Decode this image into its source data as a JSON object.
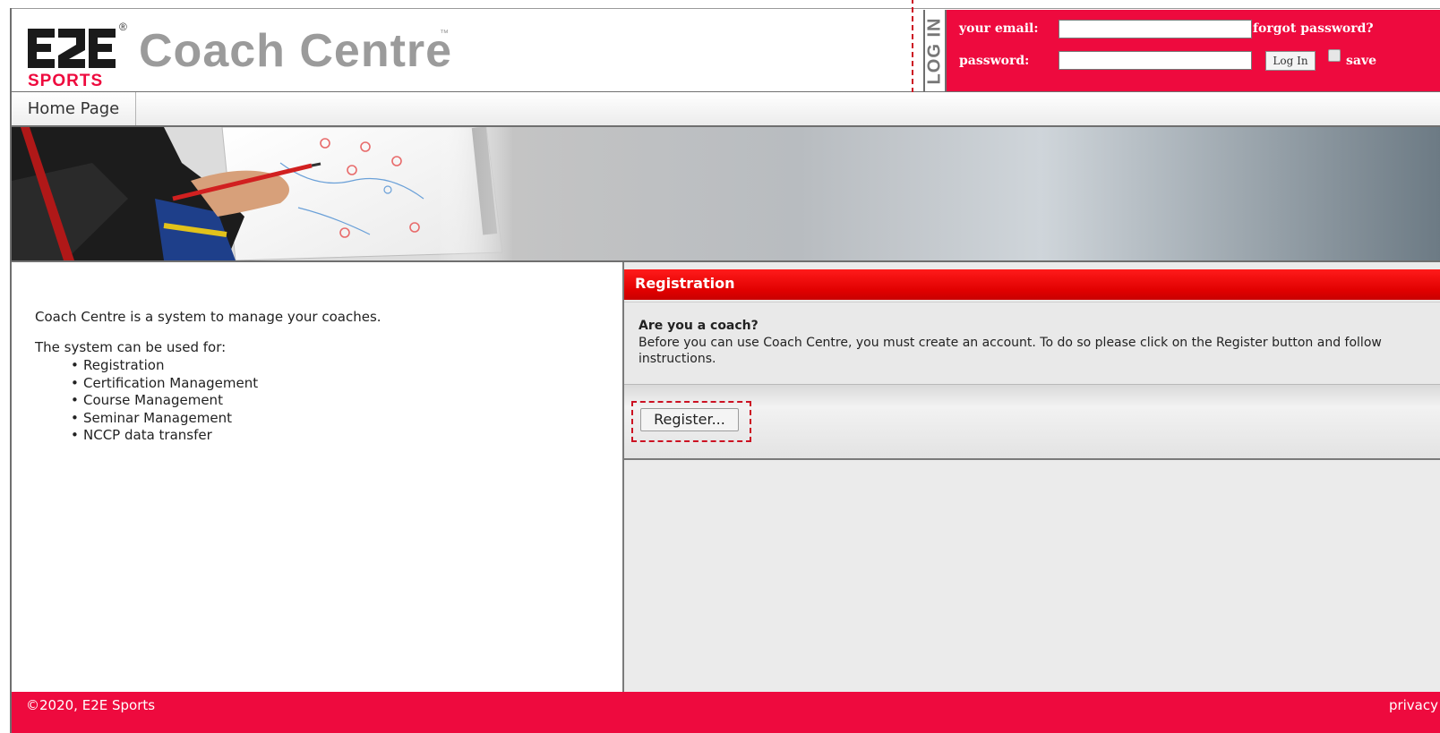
{
  "brand": {
    "logo_top": "E2E",
    "logo_bottom": "SPORTS",
    "app_title": "Coach Centre",
    "trademark": "™",
    "registered": "®"
  },
  "login": {
    "tab_label": "LOG IN",
    "email_label": "your email:",
    "password_label": "password:",
    "email_value": "",
    "password_value": "",
    "forgot_password": "forgot password?",
    "login_button": "Log In",
    "save_label": "save",
    "save_checked": false
  },
  "nav": {
    "items": [
      {
        "label": "Home Page"
      }
    ]
  },
  "intro": {
    "line1": "Coach Centre is a system to manage your coaches.",
    "line2": "The system can be used for:",
    "features": [
      "Registration",
      "Certification Management",
      "Course Management",
      "Seminar Management",
      "NCCP data transfer"
    ]
  },
  "registration": {
    "title": "Registration",
    "question": "Are you a coach?",
    "body": "Before you can use Coach Centre, you must create an account. To do so please click on the Register button and follow instructions.",
    "button": "Register..."
  },
  "footer": {
    "copyright": "©2020, E2E Sports",
    "privacy": "privacy"
  },
  "colors": {
    "accent": "#ee0a3e",
    "header_red": "#e00000",
    "title_gray": "#9b9b9b"
  }
}
